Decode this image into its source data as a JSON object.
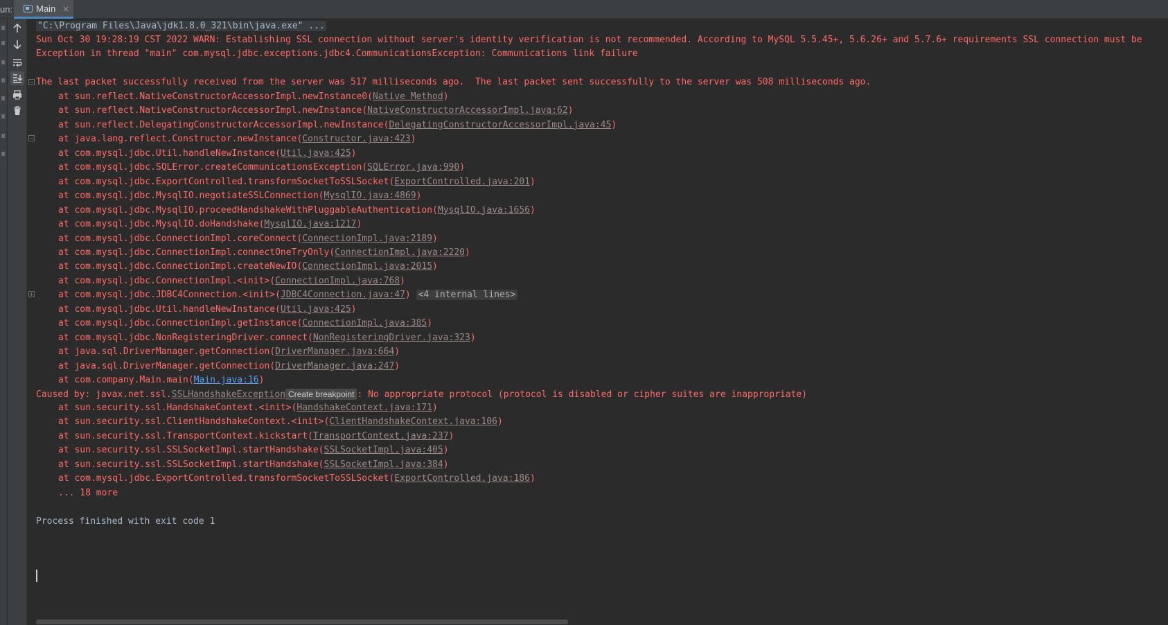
{
  "tabbar": {
    "run_label": "un:",
    "tab_label": "Main",
    "close_glyph": "×",
    "tab_icon": "console-window-icon"
  },
  "toolbar": {
    "icons": [
      "arrow-up-icon",
      "arrow-down-icon",
      "soft-wrap-icon",
      "scroll-to-end-icon",
      "print-icon",
      "trash-icon"
    ]
  },
  "console": {
    "cmd": "\"C:\\Program Files\\Java\\jdk1.8.0_321\\bin\\java.exe\" ...",
    "warn": "Sun Oct 30 19:28:19 CST 2022 WARN: Establishing SSL connection without server's identity verification is not recommended. According to MySQL 5.5.45+, 5.6.26+ and 5.7.6+ requirements SSL connection must be",
    "exception": "Exception in thread \"main\" com.mysql.jdbc.exceptions.jdbc4.CommunicationsException: Communications link failure",
    "last_packet": "The last packet successfully received from the server was 517 milliseconds ago.  The last packet sent successfully to the server was 508 milliseconds ago.",
    "frames": [
      {
        "pre": "at sun.reflect.NativeConstructorAccessorImpl.newInstance0(",
        "link": "Native Method",
        "post": ")"
      },
      {
        "pre": "at sun.reflect.NativeConstructorAccessorImpl.newInstance(",
        "link": "NativeConstructorAccessorImpl.java:62",
        "post": ")"
      },
      {
        "pre": "at sun.reflect.DelegatingConstructorAccessorImpl.newInstance(",
        "link": "DelegatingConstructorAccessorImpl.java:45",
        "post": ")"
      },
      {
        "pre": "at java.lang.reflect.Constructor.newInstance(",
        "link": "Constructor.java:423",
        "post": ")"
      },
      {
        "pre": "at com.mysql.jdbc.Util.handleNewInstance(",
        "link": "Util.java:425",
        "post": ")"
      },
      {
        "pre": "at com.mysql.jdbc.SQLError.createCommunicationsException(",
        "link": "SQLError.java:990",
        "post": ")"
      },
      {
        "pre": "at com.mysql.jdbc.ExportControlled.transformSocketToSSLSocket(",
        "link": "ExportControlled.java:201",
        "post": ")"
      },
      {
        "pre": "at com.mysql.jdbc.MysqlIO.negotiateSSLConnection(",
        "link": "MysqlIO.java:4869",
        "post": ")"
      },
      {
        "pre": "at com.mysql.jdbc.MysqlIO.proceedHandshakeWithPluggableAuthentication(",
        "link": "MysqlIO.java:1656",
        "post": ")"
      },
      {
        "pre": "at com.mysql.jdbc.MysqlIO.doHandshake(",
        "link": "MysqlIO.java:1217",
        "post": ")"
      },
      {
        "pre": "at com.mysql.jdbc.ConnectionImpl.coreConnect(",
        "link": "ConnectionImpl.java:2189",
        "post": ")"
      },
      {
        "pre": "at com.mysql.jdbc.ConnectionImpl.connectOneTryOnly(",
        "link": "ConnectionImpl.java:2220",
        "post": ")"
      },
      {
        "pre": "at com.mysql.jdbc.ConnectionImpl.createNewIO(",
        "link": "ConnectionImpl.java:2015",
        "post": ")"
      },
      {
        "pre": "at com.mysql.jdbc.ConnectionImpl.<init>(",
        "link": "ConnectionImpl.java:768",
        "post": ")"
      },
      {
        "pre": "at com.mysql.jdbc.JDBC4Connection.<init>(",
        "link": "JDBC4Connection.java:47",
        "post": ")",
        "fold": "<4 internal lines>"
      },
      {
        "pre": "at com.mysql.jdbc.Util.handleNewInstance(",
        "link": "Util.java:425",
        "post": ")"
      },
      {
        "pre": "at com.mysql.jdbc.ConnectionImpl.getInstance(",
        "link": "ConnectionImpl.java:385",
        "post": ")"
      },
      {
        "pre": "at com.mysql.jdbc.NonRegisteringDriver.connect(",
        "link": "NonRegisteringDriver.java:323",
        "post": ")"
      },
      {
        "pre": "at java.sql.DriverManager.getConnection(",
        "link": "DriverManager.java:664",
        "post": ")"
      },
      {
        "pre": "at java.sql.DriverManager.getConnection(",
        "link": "DriverManager.java:247",
        "post": ")"
      },
      {
        "pre": "at com.company.Main.main(",
        "link": "Main.java:16",
        "post": ")",
        "blue": true
      }
    ],
    "caused_pre": "Caused by: javax.net.ssl.",
    "caused_link": "SSLHandshakeException",
    "caused_bp": "Create breakpoint",
    "caused_post": ": No appropriate protocol (protocol is disabled or cipher suites are inappropriate)",
    "caused_frames": [
      {
        "pre": "at sun.security.ssl.HandshakeContext.<init>(",
        "link": "HandshakeContext.java:171",
        "post": ")"
      },
      {
        "pre": "at sun.security.ssl.ClientHandshakeContext.<init>(",
        "link": "ClientHandshakeContext.java:106",
        "post": ")"
      },
      {
        "pre": "at sun.security.ssl.TransportContext.kickstart(",
        "link": "TransportContext.java:237",
        "post": ")"
      },
      {
        "pre": "at sun.security.ssl.SSLSocketImpl.startHandshake(",
        "link": "SSLSocketImpl.java:405",
        "post": ")"
      },
      {
        "pre": "at sun.security.ssl.SSLSocketImpl.startHandshake(",
        "link": "SSLSocketImpl.java:384",
        "post": ")"
      },
      {
        "pre": "at com.mysql.jdbc.ExportControlled.transformSocketToSSLSocket(",
        "link": "ExportControlled.java:186",
        "post": ")"
      }
    ],
    "more": "... 18 more",
    "process": "Process finished with exit code 1"
  }
}
